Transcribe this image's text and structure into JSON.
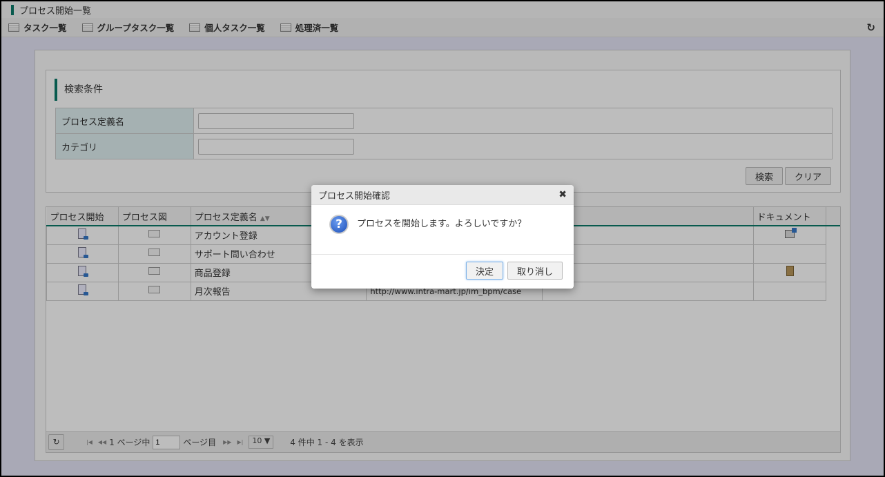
{
  "window_title": "プロセス開始一覧",
  "menu": [
    "タスク一覧",
    "グループタスク一覧",
    "個人タスク一覧",
    "処理済一覧"
  ],
  "search": {
    "title": "検索条件",
    "fields": [
      {
        "label": "プロセス定義名",
        "value": ""
      },
      {
        "label": "カテゴリ",
        "value": ""
      }
    ],
    "search_button": "検索",
    "clear_button": "クリア"
  },
  "grid": {
    "headers": [
      "プロセス開始",
      "プロセス図",
      "プロセス定義名",
      "",
      "",
      "ドキュメント"
    ],
    "rows": [
      {
        "name": "アカウント登録",
        "url": "",
        "doc": "external-link"
      },
      {
        "name": "サポート問い合わせ",
        "url": "",
        "doc": ""
      },
      {
        "name": "商品登録",
        "url": "",
        "doc": "file"
      },
      {
        "name": "月次報告",
        "url": "http://www.intra-mart.jp/im_bpm/case",
        "doc": ""
      }
    ]
  },
  "pager": {
    "total_pages_label": "1 ページ中",
    "page": "1",
    "page_suffix": "ページ目",
    "page_size": "10 ▼",
    "summary": "4 件中 1 - 4 を表示"
  },
  "dialog": {
    "title": "プロセス開始確認",
    "message": "プロセスを開始します。よろしいですか？",
    "ok": "決定",
    "cancel": "取り消し"
  }
}
